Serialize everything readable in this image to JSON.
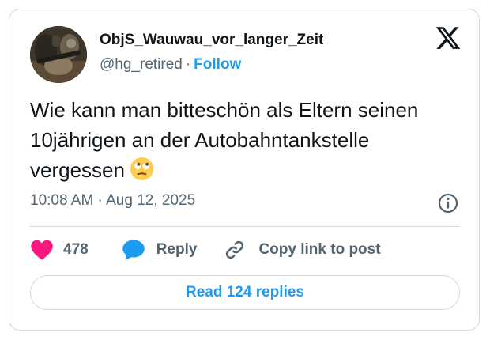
{
  "tweet": {
    "display_name": "ObjS_Wauwau_vor_langer_Zeit",
    "handle": "@hg_retired",
    "separator": "·",
    "follow_label": "Follow",
    "text": "Wie kann man bitteschön als Eltern seinen 10jährigen an der Autobahntankstelle vergessen",
    "emoji": "face-with-rolling-eyes",
    "timestamp": "10:08 AM · Aug 12, 2025"
  },
  "actions": {
    "like_count": "478",
    "reply_label": "Reply",
    "copy_link_label": "Copy link to post"
  },
  "read_replies_label": "Read 124 replies",
  "icons": {
    "brand": "x-logo-icon",
    "like": "heart-icon",
    "reply": "speech-bubble-icon",
    "copy": "link-icon",
    "info": "info-icon"
  },
  "colors": {
    "like": "#f91880",
    "reply": "#1d9bf0",
    "follow": "#1d9bf0",
    "muted": "#536471",
    "text": "#0f1419",
    "border": "#cfd9de"
  }
}
